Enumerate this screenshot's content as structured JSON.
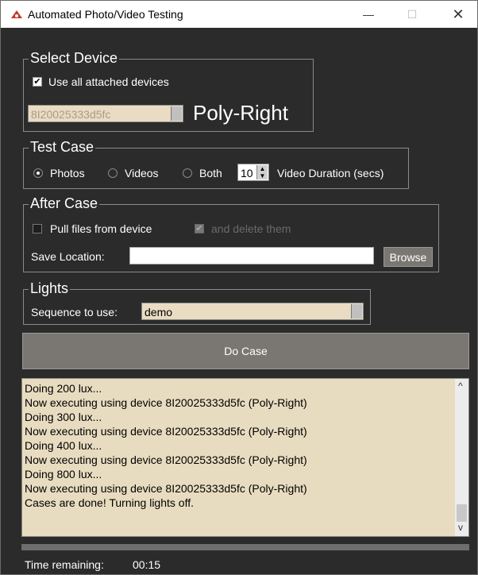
{
  "window": {
    "title": "Automated Photo/Video Testing",
    "min_glyph": "—",
    "max_glyph": "☐",
    "close_glyph": "✕"
  },
  "select_device": {
    "title": "Select Device",
    "use_all_label": "Use all attached devices",
    "use_all_checked": true,
    "device_id": "8I20025333d5fc",
    "device_name": "Poly-Right"
  },
  "test_case": {
    "title": "Test Case",
    "options": [
      "Photos",
      "Videos",
      "Both"
    ],
    "selected": "Photos",
    "duration_value": "10",
    "duration_label": "Video Duration (secs)"
  },
  "after_case": {
    "title": "After Case",
    "pull_label": "Pull files from device",
    "pull_checked": false,
    "delete_label": "and delete them",
    "delete_checked": true,
    "save_location_label": "Save Location:",
    "save_location_value": "",
    "browse_label": "Browse"
  },
  "lights": {
    "title": "Lights",
    "sequence_label": "Sequence to use:",
    "sequence_value": "demo"
  },
  "do_case_label": "Do Case",
  "log": {
    "lines": [
      "Doing 200 lux...",
      "Now executing using device 8I20025333d5fc (Poly-Right)",
      "Doing 300 lux...",
      "Now executing using device 8I20025333d5fc (Poly-Right)",
      "Doing 400 lux...",
      "Now executing using device 8I20025333d5fc (Poly-Right)",
      "Doing 800 lux...",
      "Now executing using device 8I20025333d5fc (Poly-Right)",
      "Cases are done! Turning lights off."
    ],
    "scroll_up_glyph": "^",
    "scroll_down_glyph": "v"
  },
  "progress_fraction": 0,
  "time_remaining": {
    "label": "Time remaining:",
    "value": "00:15"
  },
  "colors": {
    "background": "#2b2b2b",
    "field": "#e8dcc0",
    "button": "#7a7772"
  }
}
